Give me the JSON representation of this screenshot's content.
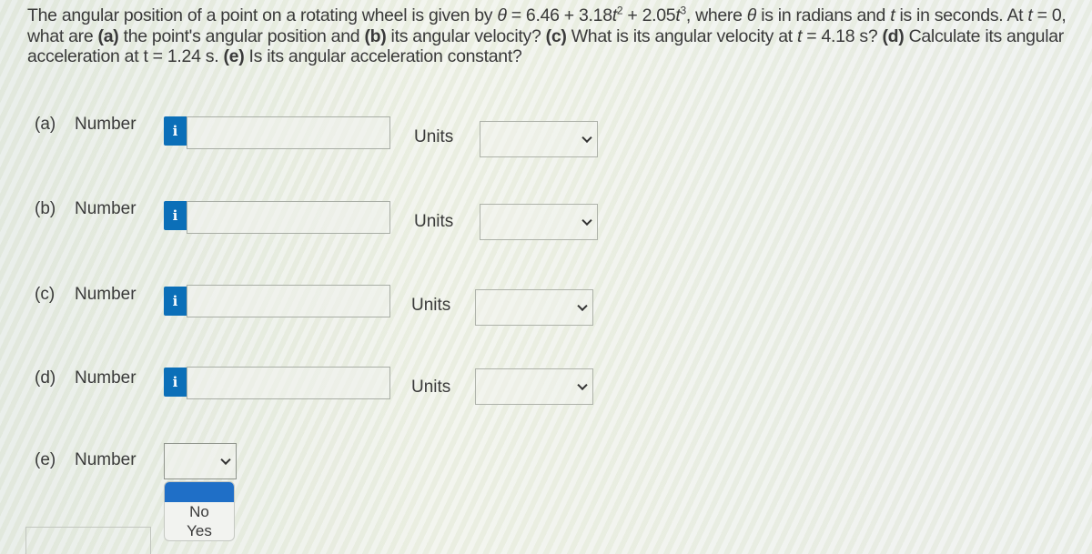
{
  "question": {
    "intro": "The angular position of a point on a rotating wheel is given by ",
    "theta_symbol": "θ",
    "equation_rhs_1": " = 6.46 + 3.18",
    "t_var": "t",
    "exp_2": "2",
    "equation_rhs_2": " + 2.05",
    "exp_3": "3",
    "after_eq": ", where ",
    "theta_units_text": " is in radians and ",
    "t_units_text": " is in seconds. At ",
    "t_eq_zero": " = 0, what are ",
    "part_a_tag": "(a)",
    "part_a_text": " the point's angular position and ",
    "part_b_tag": "(b)",
    "part_b_text": " its angular velocity? ",
    "part_c_tag": "(c)",
    "part_c_text": " What is its angular velocity at ",
    "part_c_time": " = 4.18 s? ",
    "part_d_tag": "(d)",
    "part_d_text": " Calculate its angular acceleration at t = 1.24 s. ",
    "part_e_tag": "(e)",
    "part_e_text": " Is its angular acceleration constant?"
  },
  "parts": [
    {
      "label": "(a)",
      "type": "Number",
      "info": "i",
      "value": "",
      "units_label": "Units",
      "units_value": ""
    },
    {
      "label": "(b)",
      "type": "Number",
      "info": "i",
      "value": "",
      "units_label": "Units",
      "units_value": ""
    },
    {
      "label": "(c)",
      "type": "Number",
      "info": "i",
      "value": "",
      "units_label": "Units",
      "units_value": ""
    },
    {
      "label": "(d)",
      "type": "Number",
      "info": "i",
      "value": "",
      "units_label": "Units",
      "units_value": ""
    },
    {
      "label": "(e)",
      "type": "Number",
      "value": "",
      "options": [
        "",
        "No",
        "Yes"
      ]
    }
  ],
  "colors": {
    "info_button": "#0b6fb8",
    "dropdown_highlight": "#1f6fc7"
  }
}
